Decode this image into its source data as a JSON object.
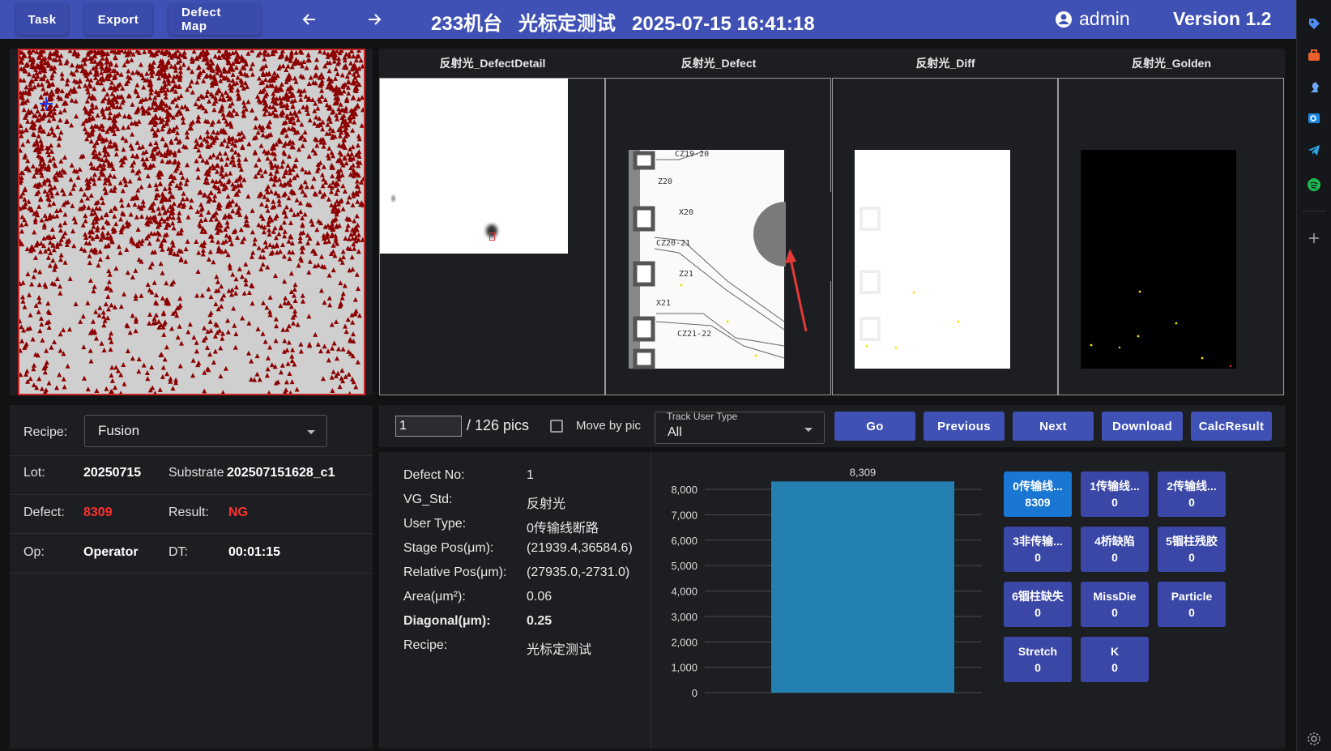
{
  "topbar": {
    "task_label": "Task",
    "export_label": "Export",
    "defect_map_label": "Defect Map",
    "title": "233机台   光标定测试   2025-07-15 16:41:18",
    "user": "admin",
    "version": "Version 1.2",
    "colors": {
      "bar": "#3f51b5"
    }
  },
  "images": {
    "titles": [
      "反射光_DefectDetail",
      "反射光_Defect",
      "反射光_Diff",
      "反射光_Golden"
    ],
    "labels": [
      "CZ19-20",
      "Z20",
      "X20",
      "CZ20-21",
      "Z21",
      "X21",
      "CZ21-22"
    ]
  },
  "info": {
    "recipe_label": "Recipe:",
    "recipe_value": "Fusion",
    "lot_label": "Lot:",
    "lot_value": "20250715",
    "substrate_label": "Substrate",
    "substrate_value": "20250715162​8_c1",
    "defect_label": "Defect:",
    "defect_value": "8309",
    "result_label": "Result:",
    "result_value": "NG",
    "op_label": "Op:",
    "op_value": "Operator",
    "dt_label": "DT:",
    "dt_value": "00:01:15"
  },
  "controls": {
    "page_value": "1",
    "page_total": "/ 126 pics",
    "move_by_pic": "Move by pic",
    "track_user_type_label": "Track User Type",
    "track_user_type_value": "All",
    "go": "Go",
    "previous": "Previous",
    "next": "Next",
    "download": "Download",
    "calc_result": "CalcResult"
  },
  "detail": {
    "rows": [
      {
        "label": "Defect No:",
        "value": "1"
      },
      {
        "label": "VG_Std:",
        "value": "反射光"
      },
      {
        "label": "User Type:",
        "value": "0传输线断路"
      },
      {
        "label": "Stage Pos(μm):",
        "value": "(21939.4,36584.6)"
      },
      {
        "label": "Relative Pos(μm):",
        "value": "(27935.0,-2731.0)"
      },
      {
        "label": "Area(μm²):",
        "value": "0.06"
      },
      {
        "label": "Diagonal(μm):",
        "value": "0.25"
      },
      {
        "label": "Recipe:",
        "value": "光标定测试"
      }
    ]
  },
  "chart_data": {
    "type": "bar",
    "categories": [
      ""
    ],
    "values": [
      8309
    ],
    "data_labels": [
      "8,309"
    ],
    "yticks": [
      "8,000",
      "7,000",
      "6,000",
      "5,000",
      "4,000",
      "3,000",
      "2,000",
      "1,000",
      "0"
    ],
    "ylim": [
      0,
      8000
    ],
    "grid": true,
    "color": "#2380b0"
  },
  "categories": [
    {
      "name": "0传输线...",
      "count": "8309",
      "active": true
    },
    {
      "name": "1传输线...",
      "count": "0"
    },
    {
      "name": "2传输线...",
      "count": "0"
    },
    {
      "name": "3非传输...",
      "count": "0"
    },
    {
      "name": "4桥缺陷",
      "count": "0"
    },
    {
      "name": "5锢柱残胶",
      "count": "0"
    },
    {
      "name": "6锢柱缺失",
      "count": "0"
    },
    {
      "name": "MissDie",
      "count": "0"
    },
    {
      "name": "Particle",
      "count": "0"
    },
    {
      "name": "Stretch",
      "count": "0"
    },
    {
      "name": "K",
      "count": "0"
    }
  ],
  "sidebar_icons": [
    "tag-icon",
    "toolbox-icon",
    "chess-icon",
    "outlook-icon",
    "telegram-icon",
    "spotify-icon",
    "add-icon",
    "settings-icon"
  ]
}
